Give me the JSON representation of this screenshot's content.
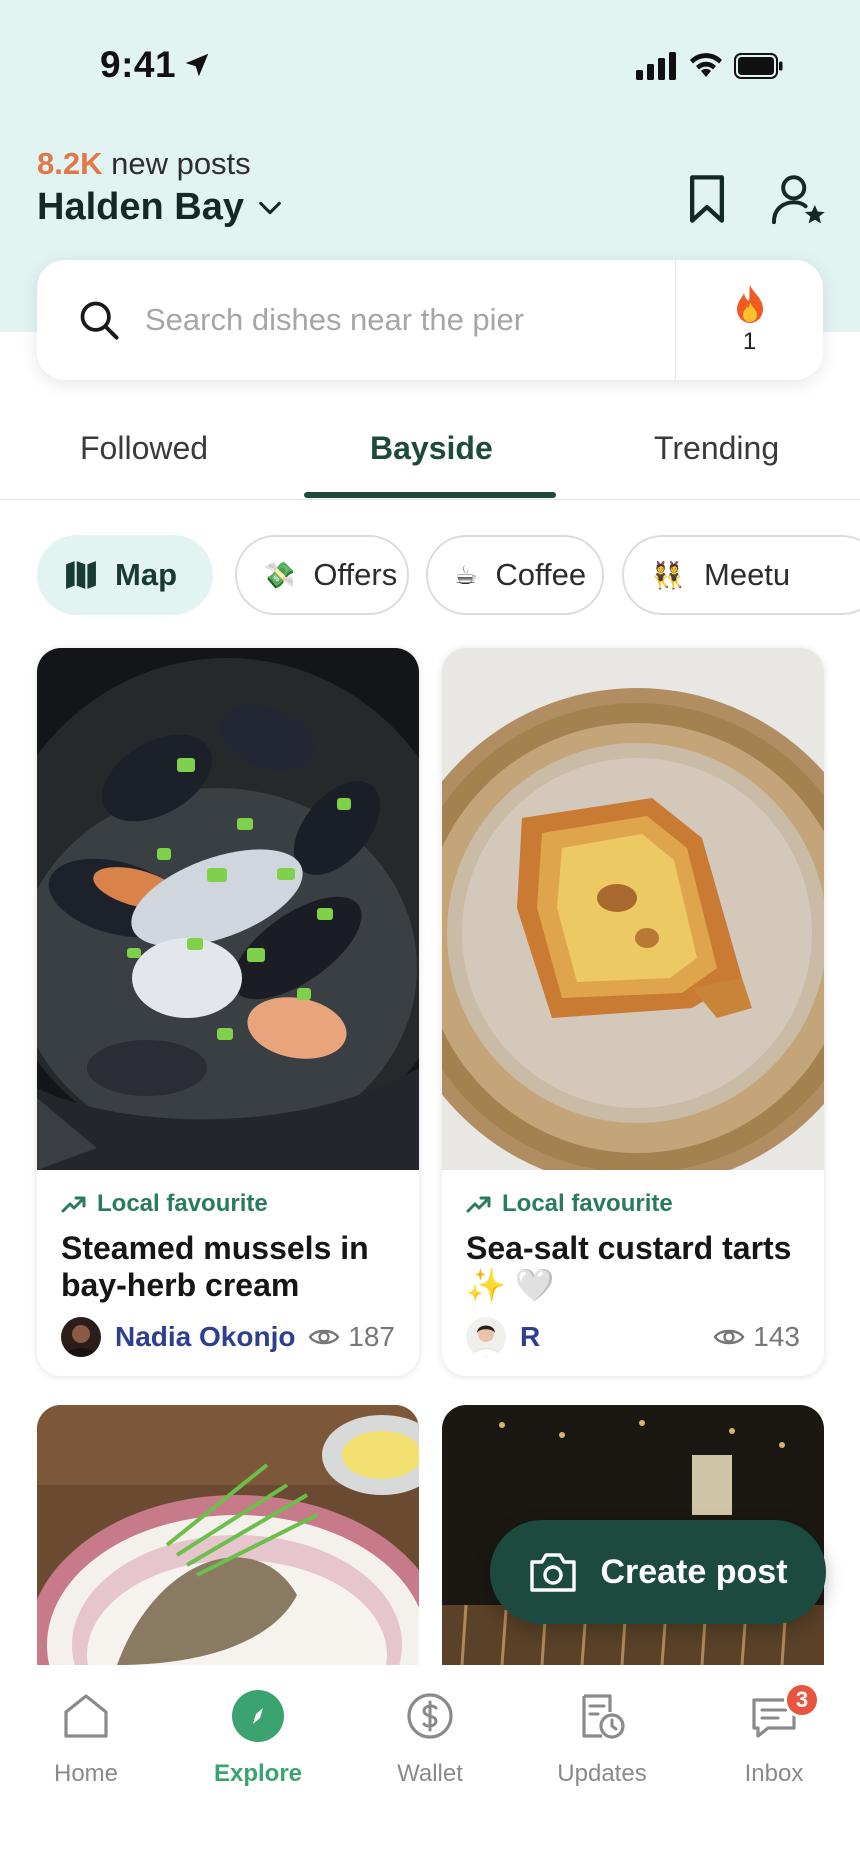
{
  "status_bar": {
    "time": "9:41"
  },
  "header": {
    "new_posts_count": "8.2K",
    "new_posts_label": " new posts",
    "location": "Halden Bay"
  },
  "search": {
    "placeholder": "Search dishes near the pier",
    "fire_count": "1"
  },
  "tabs": [
    {
      "label": "Followed"
    },
    {
      "label": "Bayside"
    },
    {
      "label": "Trending"
    }
  ],
  "active_tab": "Bayside",
  "chips": [
    {
      "label": "Map",
      "icon": "map-icon"
    },
    {
      "label": "Offers",
      "icon": "money-icon"
    },
    {
      "label": "Coffee",
      "icon": "coffee-icon"
    },
    {
      "label": "Meetu",
      "icon": "people-icon"
    }
  ],
  "cards": [
    {
      "tag": "Local favourite",
      "title": "Steamed mussels in bay-herb cream",
      "author": "Nadia Okonjo",
      "views": "187"
    },
    {
      "tag": "Local favourite",
      "title": "Sea-salt custard tarts ✨ 🤍",
      "author": "R",
      "views": "143"
    }
  ],
  "fab": {
    "label": "Create post"
  },
  "bottom_nav": [
    {
      "label": "Home"
    },
    {
      "label": "Explore"
    },
    {
      "label": "Wallet"
    },
    {
      "label": "Updates"
    },
    {
      "label": "Inbox",
      "badge": "3"
    }
  ],
  "colors": {
    "accent": "#1e4a3e",
    "header_bg": "#e2f4f2",
    "count_orange": "#e0784a",
    "tag_green": "#2a7a5e",
    "author_blue": "#2d3f8e",
    "explore_green": "#3aa370",
    "badge_red": "#e8553e"
  }
}
